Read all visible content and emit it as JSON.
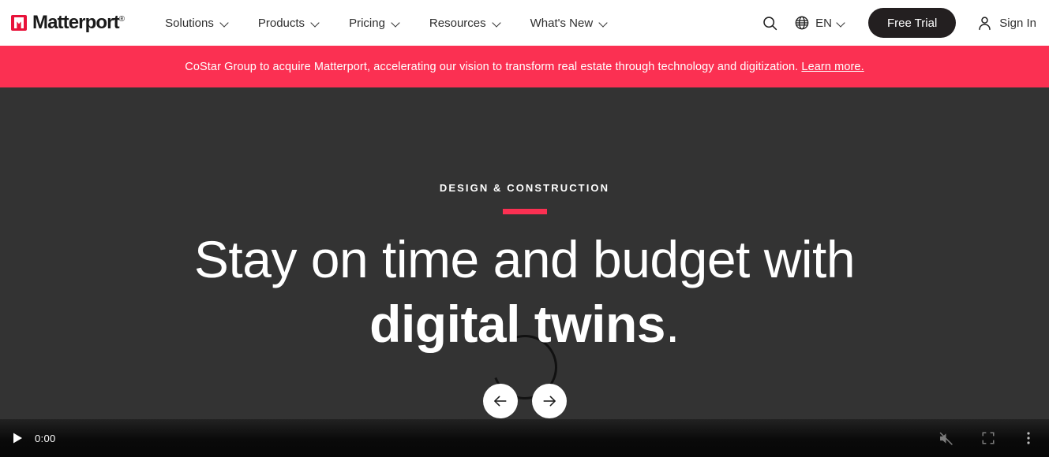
{
  "nav": {
    "logo_text": "Matterport",
    "logo_registered": "®",
    "logo_icon": "matterport-logo-icon",
    "items": [
      {
        "label": "Solutions",
        "icon": "chevron-down-icon"
      },
      {
        "label": "Products",
        "icon": "chevron-down-icon"
      },
      {
        "label": "Pricing",
        "icon": "chevron-down-icon"
      },
      {
        "label": "Resources",
        "icon": "chevron-down-icon"
      },
      {
        "label": "What's New",
        "icon": "chevron-down-icon"
      }
    ],
    "search_icon": "search-icon",
    "language": {
      "icon": "globe-icon",
      "code": "EN",
      "chevron": "chevron-down-icon"
    },
    "free_trial_label": "Free Trial",
    "sign_in": {
      "icon": "person-icon",
      "label": "Sign In"
    }
  },
  "banner": {
    "text": "CoStar Group to acquire Matterport, accelerating our vision to transform real estate through technology and digitization. ",
    "link_label": "Learn more.",
    "background_color": "#fb3052"
  },
  "hero": {
    "eyebrow": "DESIGN & CONSTRUCTION",
    "accent_color": "#fb3052",
    "headline_line1": "Stay on time and budget with",
    "headline_line2_bold": "digital twins",
    "headline_line2_period": ".",
    "background_color": "#333333",
    "carousel": {
      "prev_icon": "arrow-left-icon",
      "next_icon": "arrow-right-icon",
      "prev_label": "Previous slide",
      "next_label": "Next slide"
    },
    "loading_spinner": "loading-spinner-icon"
  },
  "video_controls": {
    "play_icon": "play-icon",
    "current_time": "0:00",
    "mute_icon": "volume-muted-icon",
    "fullscreen_icon": "fullscreen-icon",
    "more_icon": "more-options-icon"
  }
}
